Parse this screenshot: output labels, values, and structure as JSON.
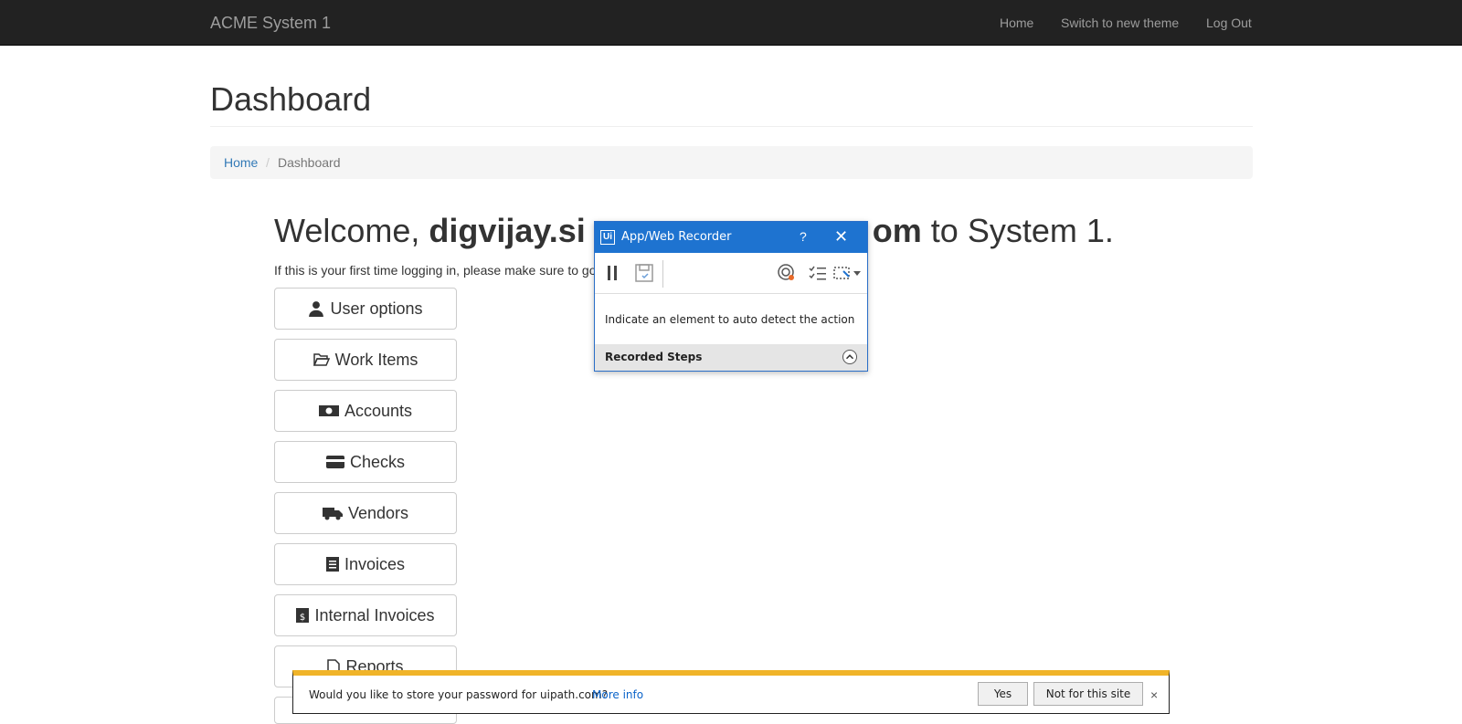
{
  "navbar": {
    "brand": "ACME System 1",
    "links": [
      "Home",
      "Switch to new theme",
      "Log Out"
    ]
  },
  "page": {
    "title": "Dashboard",
    "breadcrumb": {
      "home": "Home",
      "separator": "/",
      "current": "Dashboard"
    }
  },
  "welcome": {
    "prefix": "Welcome, ",
    "user": "digvijay.si",
    "user_tail": "om",
    "suffix": " to System 1.",
    "first_time": "If this is your first time logging in, please make sure to go"
  },
  "menu": [
    {
      "label": "User options",
      "icon": "user-icon"
    },
    {
      "label": "Work Items",
      "icon": "folder-open-icon"
    },
    {
      "label": "Accounts",
      "icon": "money-icon"
    },
    {
      "label": "Checks",
      "icon": "credit-card-icon"
    },
    {
      "label": "Vendors",
      "icon": "truck-icon"
    },
    {
      "label": "Invoices",
      "icon": "invoice-icon"
    },
    {
      "label": "Internal Invoices",
      "icon": "dollar-document-icon"
    },
    {
      "label": "Reports",
      "icon": "file-icon"
    }
  ],
  "recorder": {
    "title": "App/Web Recorder",
    "logo": "Ui",
    "help": "?",
    "close": "✕",
    "hint": "Indicate an element to auto detect the action",
    "steps_label": "Recorded Steps"
  },
  "password_bar": {
    "text": "Would you like to store your password for uipath.com?",
    "more_info": "More info",
    "yes": "Yes",
    "not_for_site": "Not for this site",
    "close": "×",
    "accent": "#f0b429"
  }
}
